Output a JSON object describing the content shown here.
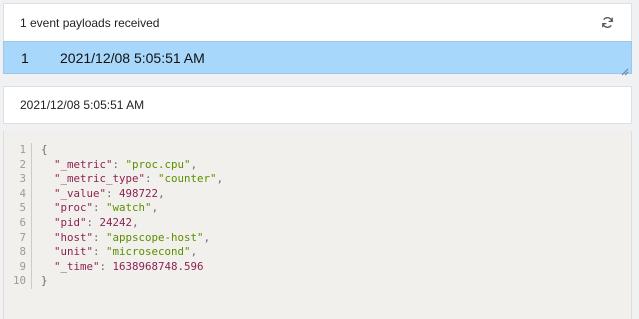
{
  "panel": {
    "title": "1 event payloads received"
  },
  "events": [
    {
      "index": "1",
      "timestamp": "2021/12/08 5:05:51 AM"
    }
  ],
  "detail": {
    "title": "2021/12/08 5:05:51 AM"
  },
  "code": {
    "lines": [
      {
        "n": "1",
        "open": "{"
      },
      {
        "n": "2",
        "key": "\"_metric\"",
        "val": "\"proc.cpu\"",
        "type": "str",
        "comma": ","
      },
      {
        "n": "3",
        "key": "\"_metric_type\"",
        "val": "\"counter\"",
        "type": "str",
        "comma": ","
      },
      {
        "n": "4",
        "key": "\"_value\"",
        "val": "498722",
        "type": "num",
        "comma": ","
      },
      {
        "n": "5",
        "key": "\"proc\"",
        "val": "\"watch\"",
        "type": "str",
        "comma": ","
      },
      {
        "n": "6",
        "key": "\"pid\"",
        "val": "24242",
        "type": "num",
        "comma": ","
      },
      {
        "n": "7",
        "key": "\"host\"",
        "val": "\"appscope-host\"",
        "type": "str",
        "comma": ","
      },
      {
        "n": "8",
        "key": "\"unit\"",
        "val": "\"microsecond\"",
        "type": "str",
        "comma": ","
      },
      {
        "n": "9",
        "key": "\"_time\"",
        "val": "1638968748.596",
        "type": "num",
        "comma": ""
      },
      {
        "n": "10",
        "open": "}"
      }
    ]
  },
  "icons": {
    "refresh": "refresh-icon",
    "resize": "resize-grip-icon"
  },
  "colors": {
    "selected_row": "#a7d7fb",
    "code_bg": "#f2f0ec",
    "json_key": "#8b2252",
    "json_string": "#5a8f00",
    "json_number": "#8b2252"
  }
}
